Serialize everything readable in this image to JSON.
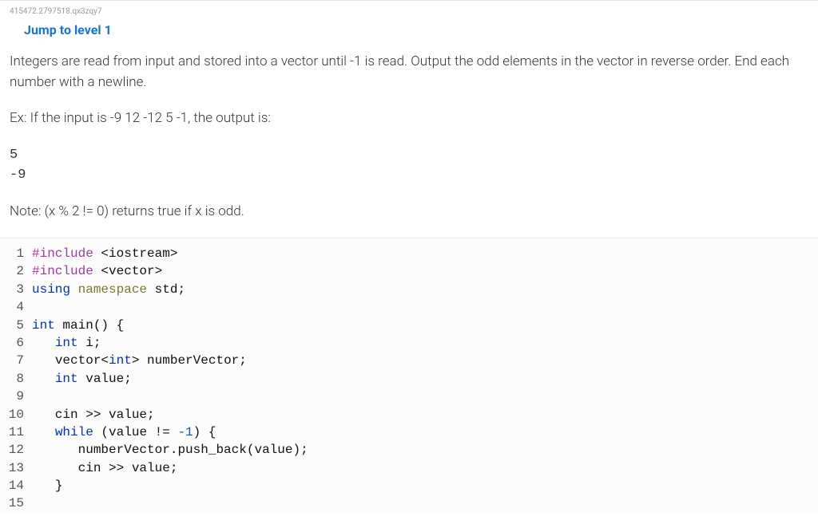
{
  "header_id": "415472.2797518.qx3zqy7",
  "jump_link": "Jump to level 1",
  "description": "Integers are read from input and stored into a vector until -1 is read. Output the odd elements in the vector in reverse order. End each number with a newline.",
  "example_prefix": "Ex: If the input is -9 12 -12 5 -1, the output is:",
  "example_output": "5\n-9",
  "note": "Note: (x % 2 != 0) returns true if x is odd.",
  "code_lines": [
    {
      "n": 1,
      "tokens": [
        [
          "kw-pp",
          "#include "
        ],
        [
          "str-hdr",
          "<iostream>"
        ]
      ]
    },
    {
      "n": 2,
      "tokens": [
        [
          "kw-pp",
          "#include "
        ],
        [
          "str-hdr",
          "<vector>"
        ]
      ]
    },
    {
      "n": 3,
      "tokens": [
        [
          "kw-lang",
          "using "
        ],
        [
          "kw-ns",
          "namespace "
        ],
        [
          "ident",
          "std"
        ],
        [
          "punct",
          ";"
        ]
      ]
    },
    {
      "n": 4,
      "tokens": []
    },
    {
      "n": 5,
      "tokens": [
        [
          "kw-lang",
          "int "
        ],
        [
          "fn",
          "main"
        ],
        [
          "punct",
          "() {"
        ]
      ]
    },
    {
      "n": 6,
      "tokens": [
        [
          "ident",
          "   "
        ],
        [
          "kw-lang",
          "int "
        ],
        [
          "ident",
          "i"
        ],
        [
          "punct",
          ";"
        ]
      ]
    },
    {
      "n": 7,
      "tokens": [
        [
          "ident",
          "   "
        ],
        [
          "ident",
          "vector"
        ],
        [
          "punct",
          "<"
        ],
        [
          "kw-lang",
          "int"
        ],
        [
          "punct",
          "> "
        ],
        [
          "ident",
          "numberVector"
        ],
        [
          "punct",
          ";"
        ]
      ]
    },
    {
      "n": 8,
      "tokens": [
        [
          "ident",
          "   "
        ],
        [
          "kw-lang",
          "int "
        ],
        [
          "ident",
          "value"
        ],
        [
          "punct",
          ";"
        ]
      ]
    },
    {
      "n": 9,
      "tokens": []
    },
    {
      "n": 10,
      "tokens": [
        [
          "ident",
          "   cin "
        ],
        [
          "op",
          ">>"
        ],
        [
          "ident",
          " value"
        ],
        [
          "punct",
          ";"
        ]
      ]
    },
    {
      "n": 11,
      "tokens": [
        [
          "ident",
          "   "
        ],
        [
          "kw-lang",
          "while "
        ],
        [
          "punct",
          "("
        ],
        [
          "ident",
          "value "
        ],
        [
          "op",
          "!= "
        ],
        [
          "num",
          "-1"
        ],
        [
          "punct",
          ") {"
        ]
      ]
    },
    {
      "n": 12,
      "tokens": [
        [
          "ident",
          "      numberVector"
        ],
        [
          "punct",
          "."
        ],
        [
          "ident",
          "push_back"
        ],
        [
          "punct",
          "("
        ],
        [
          "ident",
          "value"
        ],
        [
          "punct",
          ");"
        ]
      ]
    },
    {
      "n": 13,
      "tokens": [
        [
          "ident",
          "      cin "
        ],
        [
          "op",
          ">>"
        ],
        [
          "ident",
          " value"
        ],
        [
          "punct",
          ";"
        ]
      ]
    },
    {
      "n": 14,
      "tokens": [
        [
          "ident",
          "   "
        ],
        [
          "punct",
          "}"
        ]
      ]
    },
    {
      "n": 15,
      "tokens": []
    }
  ]
}
